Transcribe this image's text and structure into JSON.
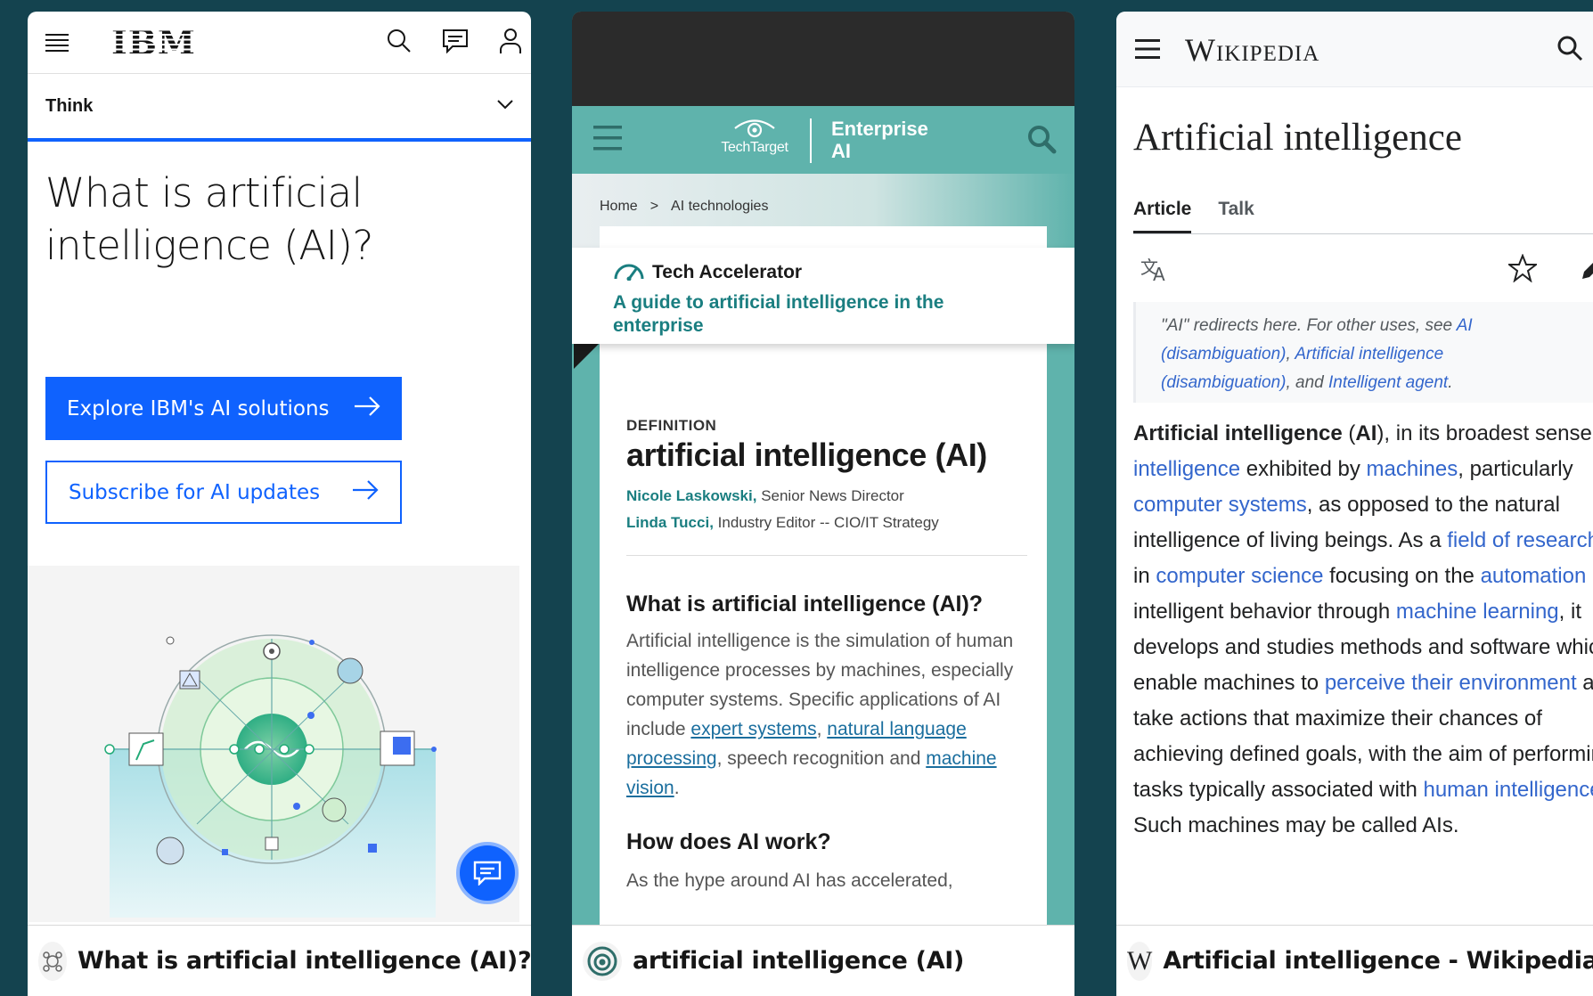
{
  "ibm": {
    "logo": "IBM",
    "nav_label": "Think",
    "heading": "What is artificial intelligence (AI)?",
    "primary_button": "Explore IBM's AI solutions",
    "secondary_button": "Subscribe for AI updates",
    "tab_title": "What is artificial intelligence (AI)?",
    "colors": {
      "accent": "#0f62fe"
    }
  },
  "techtarget": {
    "brand": "TechTarget",
    "section_line1": "Enterprise",
    "section_line2": "AI",
    "breadcrumb": [
      "Home",
      ">",
      "AI technologies"
    ],
    "accelerator_label": "Tech Accelerator",
    "accelerator_link": "A guide to artificial intelligence in the enterprise",
    "definition_label": "DEFINITION",
    "heading": "artificial intelligence (AI)",
    "authors": [
      {
        "name": "Nicole Laskowski,",
        "role": "Senior News Director"
      },
      {
        "name": "Linda Tucci,",
        "role": "Industry Editor -- CIO/IT Strategy"
      }
    ],
    "section1_heading": "What is artificial intelligence (AI)?",
    "section1_text_a": "Artificial intelligence is the simulation of human intelligence processes by machines, especially computer systems. Specific applications of AI include ",
    "link_expert": "expert systems",
    "text_comma": ", ",
    "link_nlp": "natural language processing",
    "section1_text_b": ", speech recognition and ",
    "link_vision": "machine vision",
    "text_period": ".",
    "section2_heading": "How does AI work?",
    "section2_text": "As the hype around AI has accelerated,",
    "tab_title": "artificial intelligence (AI)",
    "colors": {
      "header": "#5fb3ac",
      "link": "#1a7e80"
    }
  },
  "wikipedia": {
    "logo": "Wikipedia",
    "heading": "Artificial intelligence",
    "tabs": [
      "Article",
      "Talk"
    ],
    "hatnote": {
      "t1": "\"AI\" redirects here. For other uses, see ",
      "l1": "AI (disambiguation)",
      "t2": ", ",
      "l2": "Artificial intelligence (disambiguation)",
      "t3": ", and ",
      "l3": "Intelligent agent",
      "t4": "."
    },
    "body": {
      "b1": "Artificial intelligence",
      "t1": " (",
      "b2": "AI",
      "t2": "), in its broadest sense, is ",
      "l1": "intelligence",
      "t3": " exhibited by ",
      "l2": "machines",
      "t4": ", particularly ",
      "l3": "computer systems",
      "t5": ", as opposed to the natural intelligence of living beings. As a ",
      "l4": "field of research",
      "t6": " in ",
      "l5": "computer science",
      "t7": " focusing on the ",
      "l6": "automation",
      "t8": " of intelligent behavior through ",
      "l7": "machine learning",
      "t9": ", it develops and studies methods and software which enable machines to ",
      "l8": "perceive their environment",
      "t10": " and take actions that maximize their chances of achieving defined goals, with the aim of performing tasks typically associated with ",
      "l9": "human intelligence",
      "t11": ". Such machines may be called AIs."
    },
    "tab_title": "Artificial intelligence - Wikipedia",
    "colors": {
      "link": "#3366cc"
    }
  }
}
